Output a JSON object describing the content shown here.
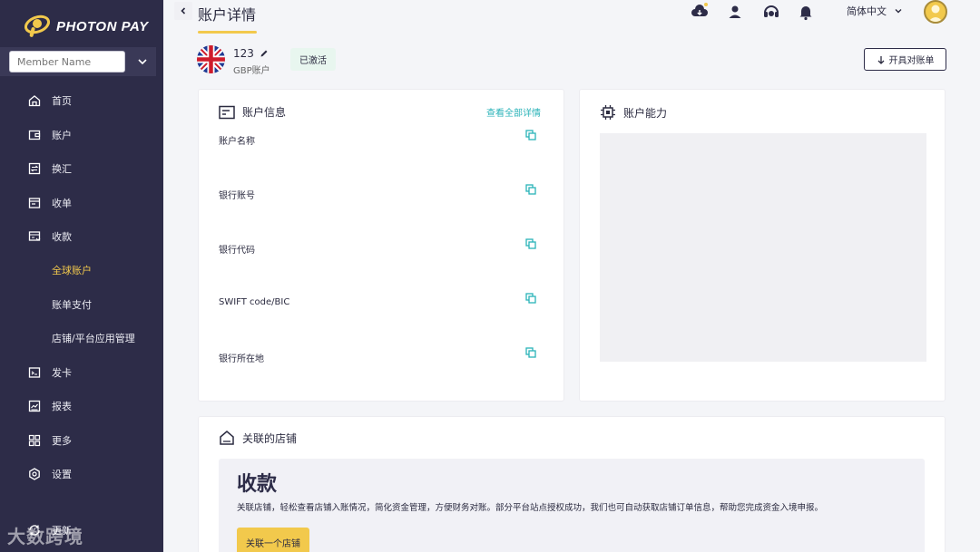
{
  "brand": {
    "name": "PHOTON PAY"
  },
  "sidebar": {
    "member_placeholder": "Member Name",
    "items": [
      {
        "label": "首页",
        "icon": "home-icon"
      },
      {
        "label": "账户",
        "icon": "wallet-icon"
      },
      {
        "label": "换汇",
        "icon": "exchange-icon"
      },
      {
        "label": "收单",
        "icon": "receipt-icon"
      },
      {
        "label": "收款",
        "icon": "collect-icon"
      },
      {
        "label": "全球账户",
        "sub": true,
        "active": true
      },
      {
        "label": "账单支付",
        "sub": true
      },
      {
        "label": "店铺/平台应用管理",
        "sub": true
      },
      {
        "label": "发卡",
        "icon": "card-icon"
      },
      {
        "label": "报表",
        "icon": "report-icon"
      },
      {
        "label": "更多",
        "icon": "grid-icon"
      },
      {
        "label": "设置",
        "icon": "gear-icon"
      },
      {
        "label": "更新",
        "icon": "update-icon"
      }
    ]
  },
  "header": {
    "title": "账户详情",
    "language": "简体中文"
  },
  "account": {
    "name": "123",
    "type": "GBP账户",
    "status": "已激活",
    "statement_button": "开具对账单"
  },
  "account_info": {
    "title": "账户信息",
    "view_all": "查看全部详情",
    "fields": [
      "账户名称",
      "银行账号",
      "银行代码",
      "SWIFT code/BIC",
      "银行所在地"
    ]
  },
  "account_ability": {
    "title": "账户能力"
  },
  "linked_shops": {
    "title": "关联的店铺",
    "heading": "收款",
    "description": "关联店铺，轻松查看店铺入账情况，简化资金管理，方便财务对账。部分平台站点授权成功，我们也可自动获取店铺订单信息，帮助您完成资金入境申报。",
    "button": "关联一个店铺"
  },
  "watermark": "大数跨境",
  "colors": {
    "sidebar_bg": "#2d2c48",
    "accent_yellow": "#f2c94c",
    "link_teal": "#2ab3b8"
  }
}
